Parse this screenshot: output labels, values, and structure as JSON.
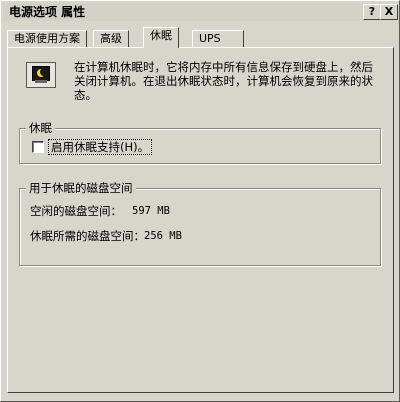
{
  "window": {
    "title": "电源选项 属性",
    "help_button": "?",
    "close_button": "X"
  },
  "tabs": [
    {
      "label": "电源使用方案",
      "active": false
    },
    {
      "label": "高级",
      "active": false
    },
    {
      "label": "休眠",
      "active": true
    },
    {
      "label": "UPS",
      "active": false
    }
  ],
  "description": "在计算机休眠时，它将内存中所有信息保存到硬盘上，然后关闭计算机。在退出休眠状态时，计算机会恢复到原来的状态。",
  "hibernate_group": {
    "title": "休眠",
    "checkbox_label": "启用休眠支持(H)。",
    "checked": false
  },
  "disk_space_group": {
    "title": "用于休眠的磁盘空间",
    "rows": [
      {
        "label": "空闲的磁盘空间：",
        "value": "597 MB"
      },
      {
        "label": "休眠所需的磁盘空间：",
        "value": "256 MB"
      }
    ]
  },
  "icons": {
    "hibernate": "monitor-moon-icon"
  }
}
